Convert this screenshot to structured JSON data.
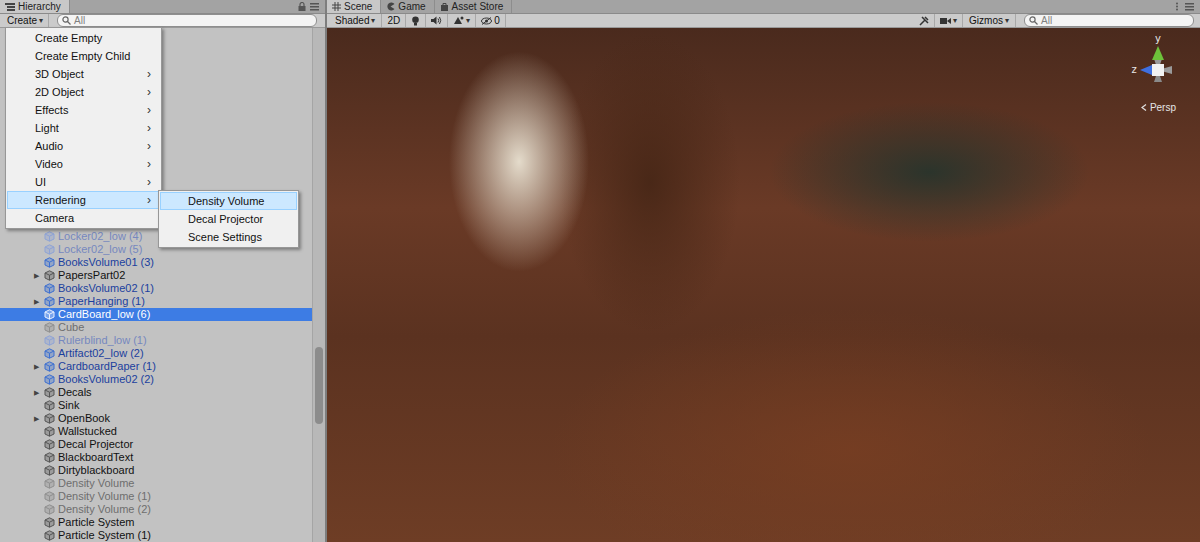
{
  "hierarchy": {
    "tab": "Hierarchy",
    "create_button": {
      "label": "Create",
      "arrow": "▾"
    },
    "search_placeholder": "All",
    "rows": [
      {
        "name": "Locker02_low (4)",
        "arrow": "",
        "prefab": true,
        "active": false,
        "selected": false
      },
      {
        "name": "Locker02_low (5)",
        "arrow": "",
        "prefab": true,
        "active": false,
        "selected": false
      },
      {
        "name": "BooksVolume01 (3)",
        "arrow": "",
        "prefab": true,
        "active": true,
        "selected": false
      },
      {
        "name": "PapersPart02",
        "arrow": "▶",
        "prefab": false,
        "active": true,
        "selected": false
      },
      {
        "name": "BooksVolume02 (1)",
        "arrow": "",
        "prefab": true,
        "active": true,
        "selected": false
      },
      {
        "name": "PaperHanging (1)",
        "arrow": "▶",
        "prefab": true,
        "active": true,
        "selected": false
      },
      {
        "name": "CardBoard_low (6)",
        "arrow": "",
        "prefab": true,
        "active": true,
        "selected": true
      },
      {
        "name": "Cube",
        "arrow": "",
        "prefab": false,
        "active": false,
        "selected": false
      },
      {
        "name": "Rulerblind_low (1)",
        "arrow": "",
        "prefab": true,
        "active": false,
        "selected": false
      },
      {
        "name": "Artifact02_low (2)",
        "arrow": "",
        "prefab": true,
        "active": true,
        "selected": false
      },
      {
        "name": "CardboardPaper (1)",
        "arrow": "▶",
        "prefab": true,
        "active": true,
        "selected": false
      },
      {
        "name": "BooksVolume02 (2)",
        "arrow": "",
        "prefab": true,
        "active": true,
        "selected": false
      },
      {
        "name": "Decals",
        "arrow": "▶",
        "prefab": false,
        "active": true,
        "selected": false
      },
      {
        "name": "Sink",
        "arrow": "",
        "prefab": false,
        "active": true,
        "selected": false
      },
      {
        "name": "OpenBook",
        "arrow": "▶",
        "prefab": false,
        "active": true,
        "selected": false
      },
      {
        "name": "Wallstucked",
        "arrow": "",
        "prefab": false,
        "active": true,
        "selected": false
      },
      {
        "name": "Decal Projector",
        "arrow": "",
        "prefab": false,
        "active": true,
        "selected": false
      },
      {
        "name": "BlackboardText",
        "arrow": "",
        "prefab": false,
        "active": true,
        "selected": false
      },
      {
        "name": "Dirtyblackboard",
        "arrow": "",
        "prefab": false,
        "active": true,
        "selected": false
      },
      {
        "name": "Density Volume",
        "arrow": "",
        "prefab": false,
        "active": false,
        "selected": false
      },
      {
        "name": "Density Volume (1)",
        "arrow": "",
        "prefab": false,
        "active": false,
        "selected": false
      },
      {
        "name": "Density Volume (2)",
        "arrow": "",
        "prefab": false,
        "active": false,
        "selected": false
      },
      {
        "name": "Particle System",
        "arrow": "",
        "prefab": false,
        "active": true,
        "selected": false
      },
      {
        "name": "Particle System (1)",
        "arrow": "",
        "prefab": false,
        "active": true,
        "selected": false
      }
    ],
    "scrollbar": {
      "position": 0.62,
      "size": 0.15
    }
  },
  "create_menu": {
    "items": [
      {
        "label": "Create Empty",
        "arrow": "",
        "selected": false
      },
      {
        "label": "Create Empty Child",
        "arrow": "",
        "selected": false
      },
      {
        "label": "3D Object",
        "arrow": "›",
        "selected": false
      },
      {
        "label": "2D Object",
        "arrow": "›",
        "selected": false
      },
      {
        "label": "Effects",
        "arrow": "›",
        "selected": false
      },
      {
        "label": "Light",
        "arrow": "›",
        "selected": false
      },
      {
        "label": "Audio",
        "arrow": "›",
        "selected": false
      },
      {
        "label": "Video",
        "arrow": "›",
        "selected": false
      },
      {
        "label": "UI",
        "arrow": "›",
        "selected": false
      },
      {
        "label": "Rendering",
        "arrow": "›",
        "selected": true
      },
      {
        "label": "Camera",
        "arrow": "",
        "selected": false
      }
    ]
  },
  "rendering_submenu": {
    "items": [
      {
        "label": "Density Volume",
        "selected": true
      },
      {
        "label": "Decal Projector",
        "selected": false
      },
      {
        "label": "Scene Settings",
        "selected": false
      }
    ]
  },
  "scene": {
    "tabs": [
      {
        "label": "Scene",
        "kind": "scene",
        "selected": true
      },
      {
        "label": "Game",
        "kind": "game",
        "selected": false
      },
      {
        "label": "Asset Store",
        "kind": "store",
        "selected": false
      }
    ],
    "toolbar": {
      "shading": {
        "label": "Shaded",
        "arrow": "▾"
      },
      "mode_2d": {
        "label": "2D",
        "selected": false
      },
      "effects_arrow": "▾",
      "hidden_count": "0",
      "camera_arrow": "▾",
      "gizmos": {
        "label": "Gizmos",
        "arrow": "▾"
      },
      "search_placeholder": "All"
    },
    "gizmo": {
      "axes": [
        "y",
        "z"
      ],
      "projection": "Persp"
    }
  }
}
